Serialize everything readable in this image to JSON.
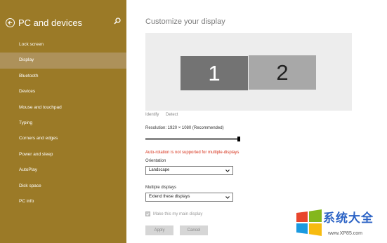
{
  "sidebar": {
    "title": "PC and devices",
    "items": [
      {
        "label": "Lock screen"
      },
      {
        "label": "Display"
      },
      {
        "label": "Bluetooth"
      },
      {
        "label": "Devices"
      },
      {
        "label": "Mouse and touchpad"
      },
      {
        "label": "Typing"
      },
      {
        "label": "Corners and edges"
      },
      {
        "label": "Power and sleep"
      },
      {
        "label": "AutoPlay"
      },
      {
        "label": "Disk space"
      },
      {
        "label": "PC info"
      }
    ],
    "selected": "Display",
    "bg_color": "#9b7a27",
    "selected_color": "#ad915a"
  },
  "main": {
    "title": "Customize your display",
    "monitors": [
      {
        "label": "1"
      },
      {
        "label": "2"
      }
    ],
    "identify": "Identify",
    "detect": "Detect",
    "resolution_label": "Resolution: 1920 × 1080 (Recommended)",
    "resolution_slider_value": 1.0,
    "warning": "Auto-rotation is not supported for multiple-displays",
    "orientation_label": "Orientation",
    "orientation_value": "Landscape",
    "multiple_displays_label": "Multiple displays",
    "multiple_displays_value": "Extend these displays",
    "main_display_label": "Make this my main display",
    "main_display_checked": true,
    "apply": "Apply",
    "cancel": "Cancel",
    "warning_color": "#d6311a"
  },
  "watermark": {
    "text": "系统大全",
    "url": "www.XP85.com"
  }
}
